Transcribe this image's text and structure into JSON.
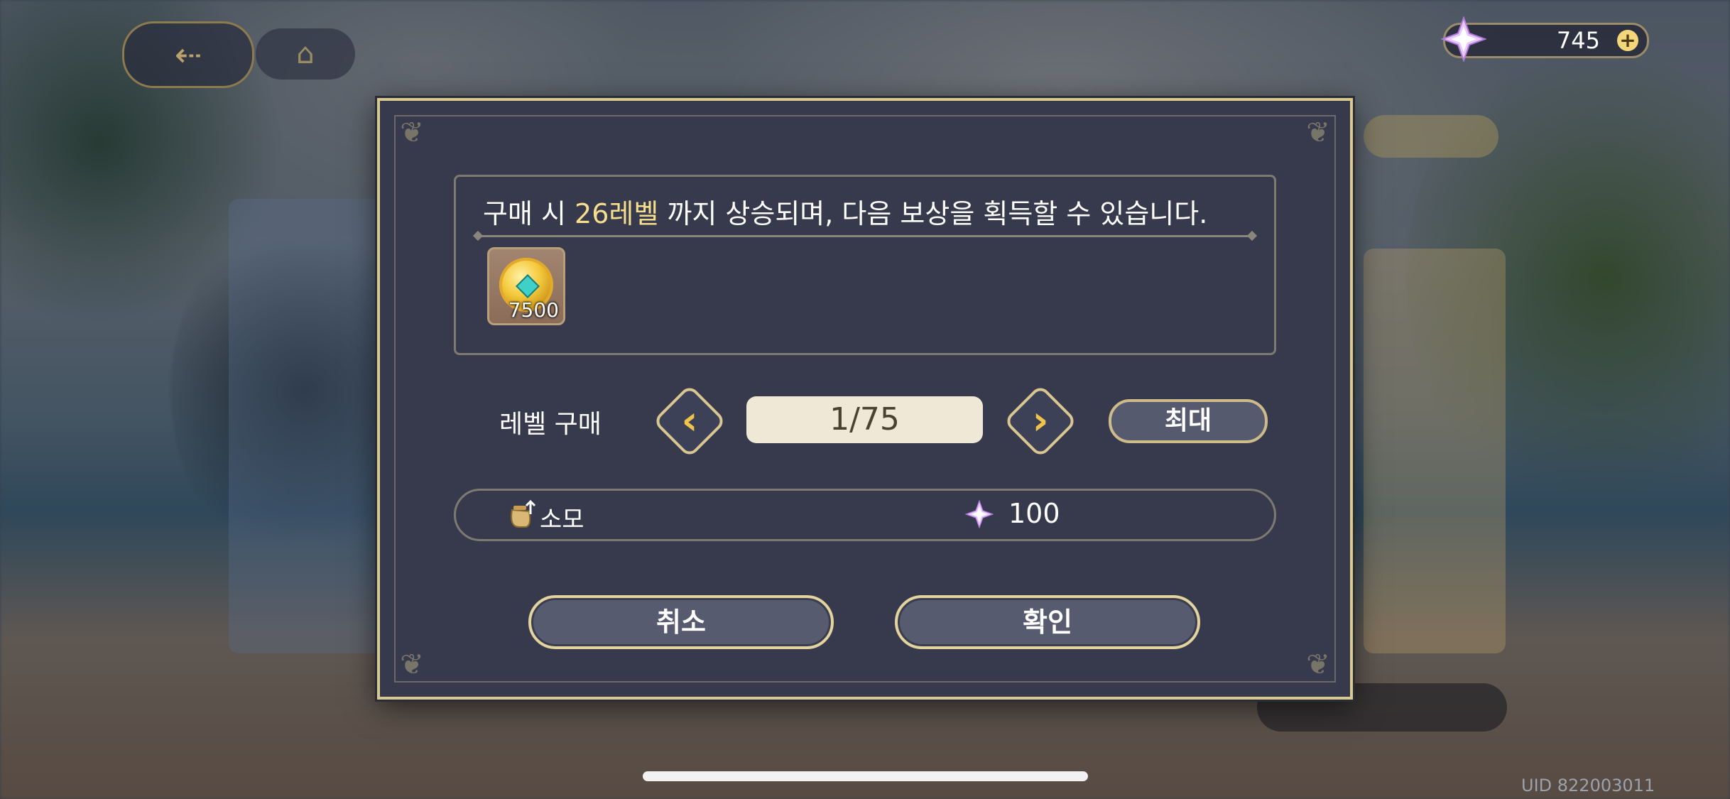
{
  "currency": {
    "amount": "745",
    "icon": "crystal-gem-icon",
    "plus": "+"
  },
  "dialog": {
    "message_prefix": "구매 시 ",
    "message_highlight": "26레벨",
    "message_suffix": " 까지 상승되며, 다음 보상을 획득할 수 있습니다.",
    "reward": {
      "icon": "gold-coin-icon",
      "count": "7500"
    },
    "level_purchase": {
      "label": "레벨 구매",
      "value": "1/75",
      "prev_icon": "chevron-left-icon",
      "next_icon": "chevron-right-icon",
      "max_label": "최대"
    },
    "cost": {
      "label": "소모",
      "icon": "bag-icon",
      "currency_icon": "crystal-gem-icon",
      "value": "100"
    },
    "cancel_label": "취소",
    "confirm_label": "확인"
  },
  "uid": "UID 822003011",
  "colors": {
    "highlight": "#f5df8e",
    "dialog_bg": "#373a4c",
    "gold_border": "#d8c98e"
  }
}
